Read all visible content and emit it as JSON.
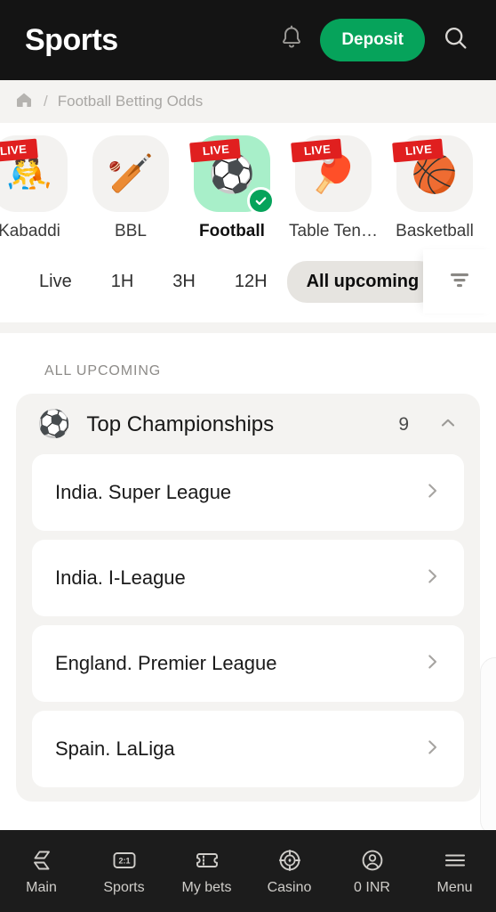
{
  "header": {
    "title": "Sports",
    "bell_icon": "bell-icon",
    "deposit_label": "Deposit",
    "search_icon": "search-icon"
  },
  "breadcrumb": {
    "home_icon": "home-icon",
    "separator": "/",
    "current": "Football Betting Odds"
  },
  "sports_carousel": [
    {
      "label": "Kabaddi",
      "emoji": "🤼",
      "live": "LIVE",
      "selected": false
    },
    {
      "label": "BBL",
      "emoji": "🏏",
      "live": "",
      "selected": false
    },
    {
      "label": "Football",
      "emoji": "⚽",
      "live": "LIVE",
      "selected": true
    },
    {
      "label": "Table Ten…",
      "emoji": "🏓",
      "live": "LIVE",
      "selected": false
    },
    {
      "label": "Basketball",
      "emoji": "🏀",
      "live": "LIVE",
      "selected": false
    }
  ],
  "time_filters": [
    {
      "label": "Live",
      "active": false
    },
    {
      "label": "1H",
      "active": false
    },
    {
      "label": "3H",
      "active": false
    },
    {
      "label": "12H",
      "active": false
    },
    {
      "label": "All upcoming",
      "active": true
    }
  ],
  "filter_button_icon": "filter-icon",
  "section": {
    "label": "ALL UPCOMING",
    "group": {
      "icon": "⚽",
      "title": "Top Championships",
      "count": "9",
      "expanded": true
    },
    "leagues": [
      {
        "name": "India. Super League"
      },
      {
        "name": "India. I-League"
      },
      {
        "name": "England. Premier League"
      },
      {
        "name": "Spain. LaLiga"
      }
    ]
  },
  "bottom_nav": [
    {
      "label": "Main",
      "icon": "main-icon"
    },
    {
      "label": "Sports",
      "icon": "scoreboard-icon"
    },
    {
      "label": "My bets",
      "icon": "ticket-icon"
    },
    {
      "label": "Casino",
      "icon": "casino-chip-icon"
    },
    {
      "label": "0 INR",
      "icon": "user-circle-icon"
    },
    {
      "label": "Menu",
      "icon": "hamburger-icon"
    }
  ],
  "colors": {
    "accent_green": "#06a35b",
    "selected_tile": "#a8efc9",
    "live_red": "#e01f1f",
    "header_bg": "#141414",
    "nav_bg": "#1c1c1c"
  }
}
